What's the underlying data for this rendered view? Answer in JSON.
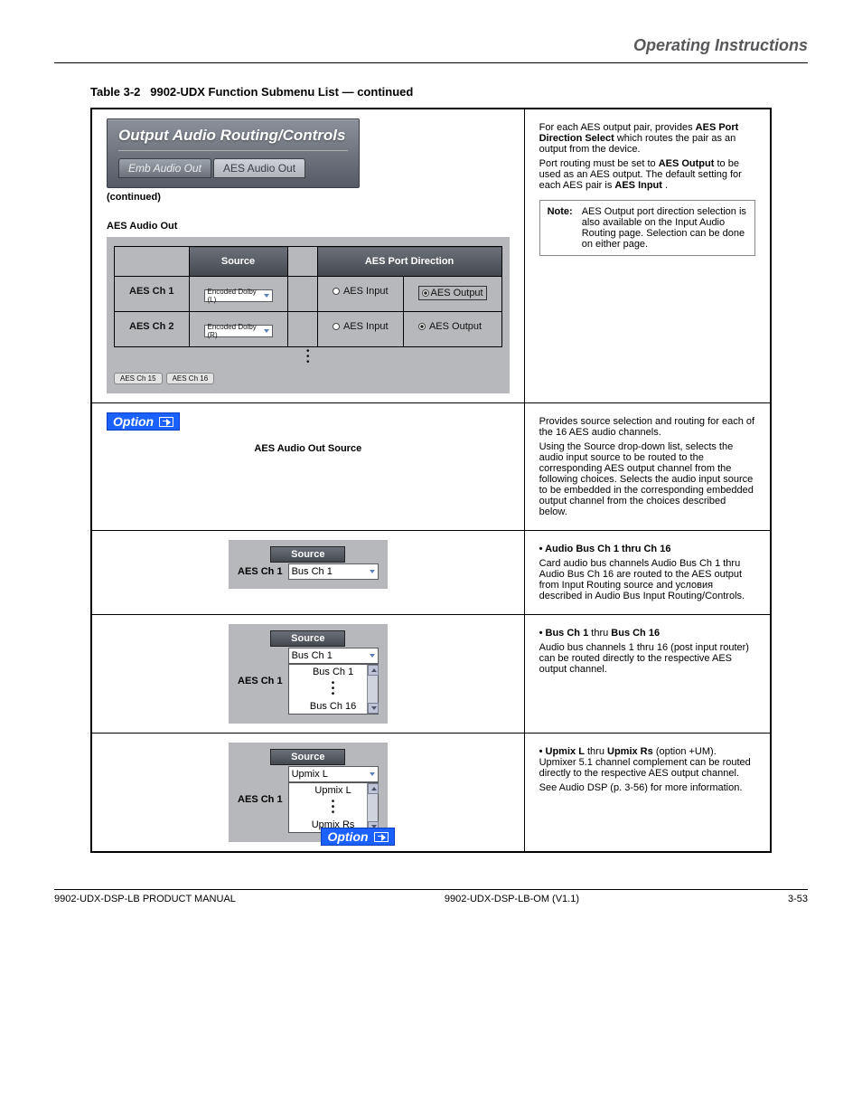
{
  "header": {
    "right": "Operating Instructions"
  },
  "table_caption": {
    "prefix": "Table 3-2",
    "title": "9902-UDX Function Submenu List — continued"
  },
  "ribbon": {
    "title": "Output Audio Routing/Controls",
    "tab_active": "Emb Audio Out",
    "tab_inactive": "AES Audio Out",
    "cont": "(continued)"
  },
  "row1": {
    "left_caption": "AES Audio Out",
    "desc1": "For each AES output pair, provides",
    "desc1_bold": "AES Port Direction Select",
    "desc1_cont": " which routes the pair as an output from the device.",
    "desc2": "Port routing must be set to ",
    "desc2_bold1": "AES Output",
    "desc2_mid": " to be used as an AES output. The default setting for each AES pair is ",
    "desc2_bold2": "AES Input",
    "desc2_end": ".",
    "note_lbl": "Note:",
    "note": "AES Output port direction selection is also available on the Input Audio Routing page. Selection can be done on either page.",
    "hdr_source": "Source",
    "hdr_port": "AES Port Direction",
    "rows": [
      {
        "lbl": "AES Ch 1",
        "src": "Encoded Dolby (L)",
        "inp": "AES Input",
        "out": "AES Output",
        "sel": "out"
      },
      {
        "lbl": "AES Ch 2",
        "src": "Encoded Dolby (R)",
        "inp": "AES Input",
        "out": "AES Output",
        "sel": "out"
      }
    ],
    "chips": [
      "AES Ch 15",
      "AES Ch 16"
    ]
  },
  "row2": {
    "heading": "AES Audio Out Source",
    "text1": "Provides source selection and routing for each of the 16 AES audio channels.",
    "text2": "Using the Source drop-down list, selects the audio input source to be routed to the corresponding AES output channel from the following choices. Selects the audio input source to be embedded in the corresponding embedded output channel from the choices described below.",
    "option_lbl": "Option"
  },
  "row3": {
    "hdr_source": "Source",
    "row_lbl": "AES Ch 1",
    "val": "Bus Ch 1",
    "right_title": "• Audio Bus Ch 1 thru Ch 16",
    "right_text": "Card audio bus channels Audio Bus Ch 1 thru Audio Bus Ch 16 are routed to the AES output from Input Routing source and условия described in Audio Bus Input Routing/Controls."
  },
  "row4": {
    "hdr_source": "Source",
    "row_lbl": "AES Ch 1",
    "val": "Bus Ch 1",
    "opt1": "Bus Ch 1",
    "opt2": "Bus Ch 16",
    "right_title": "• Bus Ch 1",
    "right_text_a": " thru ",
    "right_title_b": "Bus Ch 16",
    "right_text": "Audio bus channels 1 thru 16 (post input router) can be routed directly to the respective AES output channel."
  },
  "row5": {
    "hdr_source": "Source",
    "row_lbl": "AES Ch 1",
    "val": "Upmix L",
    "opt1": "Upmix L",
    "opt2": "Upmix Rs",
    "right_title_a": "• Upmix L",
    "right_mid": " thru ",
    "right_title_b": "Upmix Rs",
    "right_text": " (option +UM). Upmixer 5.1 channel complement can be routed directly to the respective AES output channel.",
    "right_text2": "See Audio DSP (p. 3-56) for more information.",
    "option_lbl": "Option"
  },
  "footer": {
    "left": "9902-UDX-DSP-LB PRODUCT MANUAL",
    "middle": "9902-UDX-DSP-LB-OM (V1.1)",
    "right": "3-53"
  }
}
